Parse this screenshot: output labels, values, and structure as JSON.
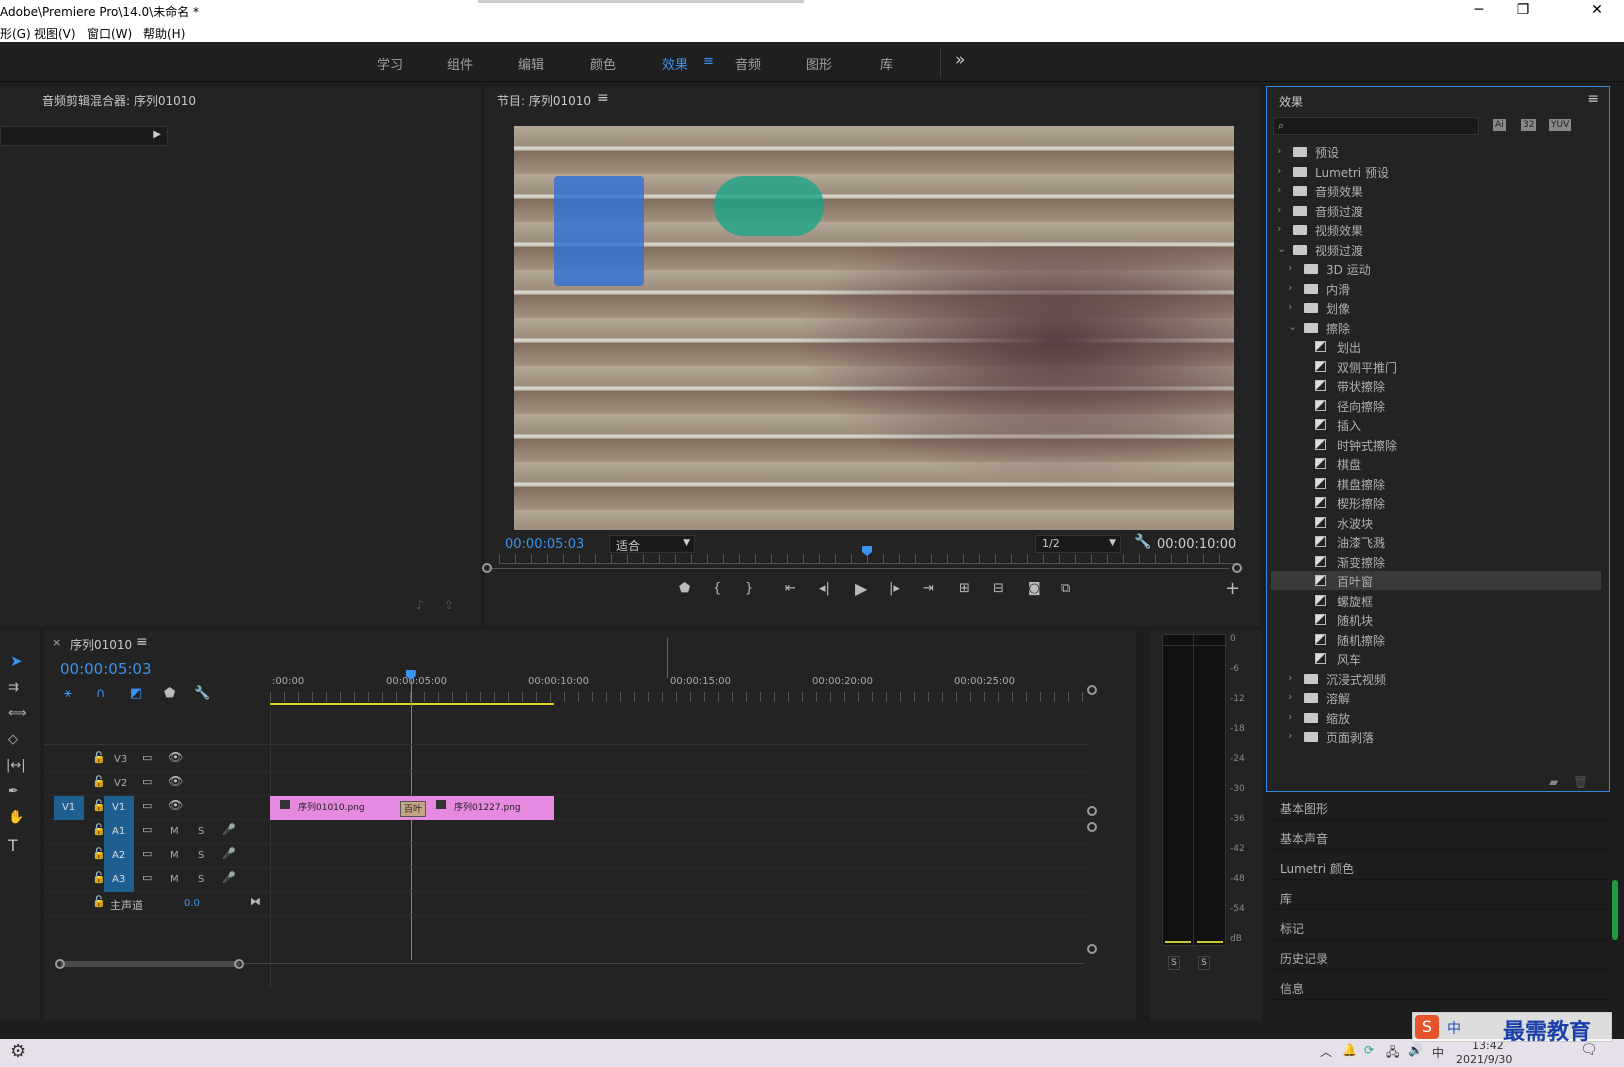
{
  "window": {
    "title": "Adobe\\Premiere Pro\\14.0\\未命名 *",
    "minimize": "─",
    "maximize": "❐",
    "close": "✕"
  },
  "menu": [
    "形(G)",
    "视图(V)",
    "窗口(W)",
    "帮助(H)"
  ],
  "workspaces": [
    {
      "label": "学习"
    },
    {
      "label": "组件"
    },
    {
      "label": "编辑"
    },
    {
      "label": "颜色"
    },
    {
      "label": "效果",
      "active": true
    },
    {
      "label": "音频"
    },
    {
      "label": "图形"
    },
    {
      "label": "库"
    }
  ],
  "workspace_menu_icon": "≡",
  "workspace_more": "»",
  "audio_mixer": {
    "title": "音频剪辑混合器: 序列01010"
  },
  "program": {
    "title": "节目: 序列01010",
    "menu_icon": "≡",
    "timecode": "00:00:05:03",
    "fit": "适合",
    "resolution": "1/2",
    "duration": "00:00:10:00",
    "progress": 0.5
  },
  "transport": [
    "marker-icon",
    "mark-in-icon",
    "mark-out-icon",
    "go-to-in-icon",
    "step-back-icon",
    "play-icon",
    "step-forward-icon",
    "go-to-out-icon",
    "lift-icon",
    "extract-icon",
    "export-frame-icon",
    "comparison-view-icon",
    "add-button-icon"
  ],
  "effects": {
    "title": "效果",
    "menu_icon": "≡",
    "search_placeholder": "",
    "badges": [
      "Ai",
      "32",
      "YUV"
    ],
    "tree": [
      {
        "label": "预设",
        "level": 0,
        "type": "folder",
        "open": false
      },
      {
        "label": "Lumetri 预设",
        "level": 0,
        "type": "folder",
        "open": false
      },
      {
        "label": "音频效果",
        "level": 0,
        "type": "folder",
        "open": false
      },
      {
        "label": "音频过渡",
        "level": 0,
        "type": "folder",
        "open": false
      },
      {
        "label": "视频效果",
        "level": 0,
        "type": "folder",
        "open": false
      },
      {
        "label": "视频过渡",
        "level": 0,
        "type": "folder",
        "open": true
      },
      {
        "label": "3D 运动",
        "level": 1,
        "type": "folder",
        "open": false
      },
      {
        "label": "内滑",
        "level": 1,
        "type": "folder",
        "open": false
      },
      {
        "label": "划像",
        "level": 1,
        "type": "folder",
        "open": false
      },
      {
        "label": "擦除",
        "level": 1,
        "type": "folder",
        "open": true
      },
      {
        "label": "划出",
        "level": 2,
        "type": "fx"
      },
      {
        "label": "双侧平推门",
        "level": 2,
        "type": "fx"
      },
      {
        "label": "带状擦除",
        "level": 2,
        "type": "fx"
      },
      {
        "label": "径向擦除",
        "level": 2,
        "type": "fx"
      },
      {
        "label": "插入",
        "level": 2,
        "type": "fx"
      },
      {
        "label": "时钟式擦除",
        "level": 2,
        "type": "fx"
      },
      {
        "label": "棋盘",
        "level": 2,
        "type": "fx"
      },
      {
        "label": "棋盘擦除",
        "level": 2,
        "type": "fx"
      },
      {
        "label": "楔形擦除",
        "level": 2,
        "type": "fx"
      },
      {
        "label": "水波块",
        "level": 2,
        "type": "fx"
      },
      {
        "label": "油漆飞溅",
        "level": 2,
        "type": "fx"
      },
      {
        "label": "渐变擦除",
        "level": 2,
        "type": "fx"
      },
      {
        "label": "百叶窗",
        "level": 2,
        "type": "fx",
        "selected": true
      },
      {
        "label": "螺旋框",
        "level": 2,
        "type": "fx"
      },
      {
        "label": "随机块",
        "level": 2,
        "type": "fx"
      },
      {
        "label": "随机擦除",
        "level": 2,
        "type": "fx"
      },
      {
        "label": "风车",
        "level": 2,
        "type": "fx"
      },
      {
        "label": "沉浸式视频",
        "level": 1,
        "type": "folder",
        "open": false
      },
      {
        "label": "溶解",
        "level": 1,
        "type": "folder",
        "open": false
      },
      {
        "label": "缩放",
        "level": 1,
        "type": "folder",
        "open": false
      },
      {
        "label": "页面剥落",
        "level": 1,
        "type": "folder",
        "open": false
      }
    ]
  },
  "side_panels": [
    "基本图形",
    "基本声音",
    "Lumetri 颜色",
    "库",
    "标记",
    "历史记录",
    "信息"
  ],
  "timeline": {
    "tab_close": "×",
    "title": "序列01010",
    "menu_icon": "≡",
    "timecode": "00:00:05:03",
    "ruler": [
      ":00:00",
      "00:00:05:00",
      "00:00:10:00",
      "00:00:15:00",
      "00:00:20:00",
      "00:00:25:00"
    ],
    "playhead_progress": 0.176,
    "video_tracks": [
      {
        "name": "V3"
      },
      {
        "name": "V2"
      },
      {
        "name": "V1",
        "source": "V1"
      }
    ],
    "audio_tracks": [
      {
        "name": "A1"
      },
      {
        "name": "A2"
      },
      {
        "name": "A3"
      }
    ],
    "m": "M",
    "s": "S",
    "master": {
      "label": "主声道",
      "value": "0.0"
    },
    "clips": [
      {
        "name": "序列01010.png"
      },
      {
        "name": "序列01227.png"
      }
    ],
    "transition": "百叶"
  },
  "meter": {
    "ticks": [
      "0",
      "-6",
      "-12",
      "-18",
      "-24",
      "-30",
      "-36",
      "-42",
      "-48",
      "-54",
      "dB"
    ],
    "solo": [
      "S",
      "S"
    ]
  },
  "taskbar": {
    "time": "13:42",
    "date": "2021/9/30",
    "ime": "中",
    "watermark": "最需教育"
  },
  "colors": {
    "accent": "#2d8ceb",
    "clip": "#e58ae0",
    "panel_border": "#2d8ceb"
  }
}
